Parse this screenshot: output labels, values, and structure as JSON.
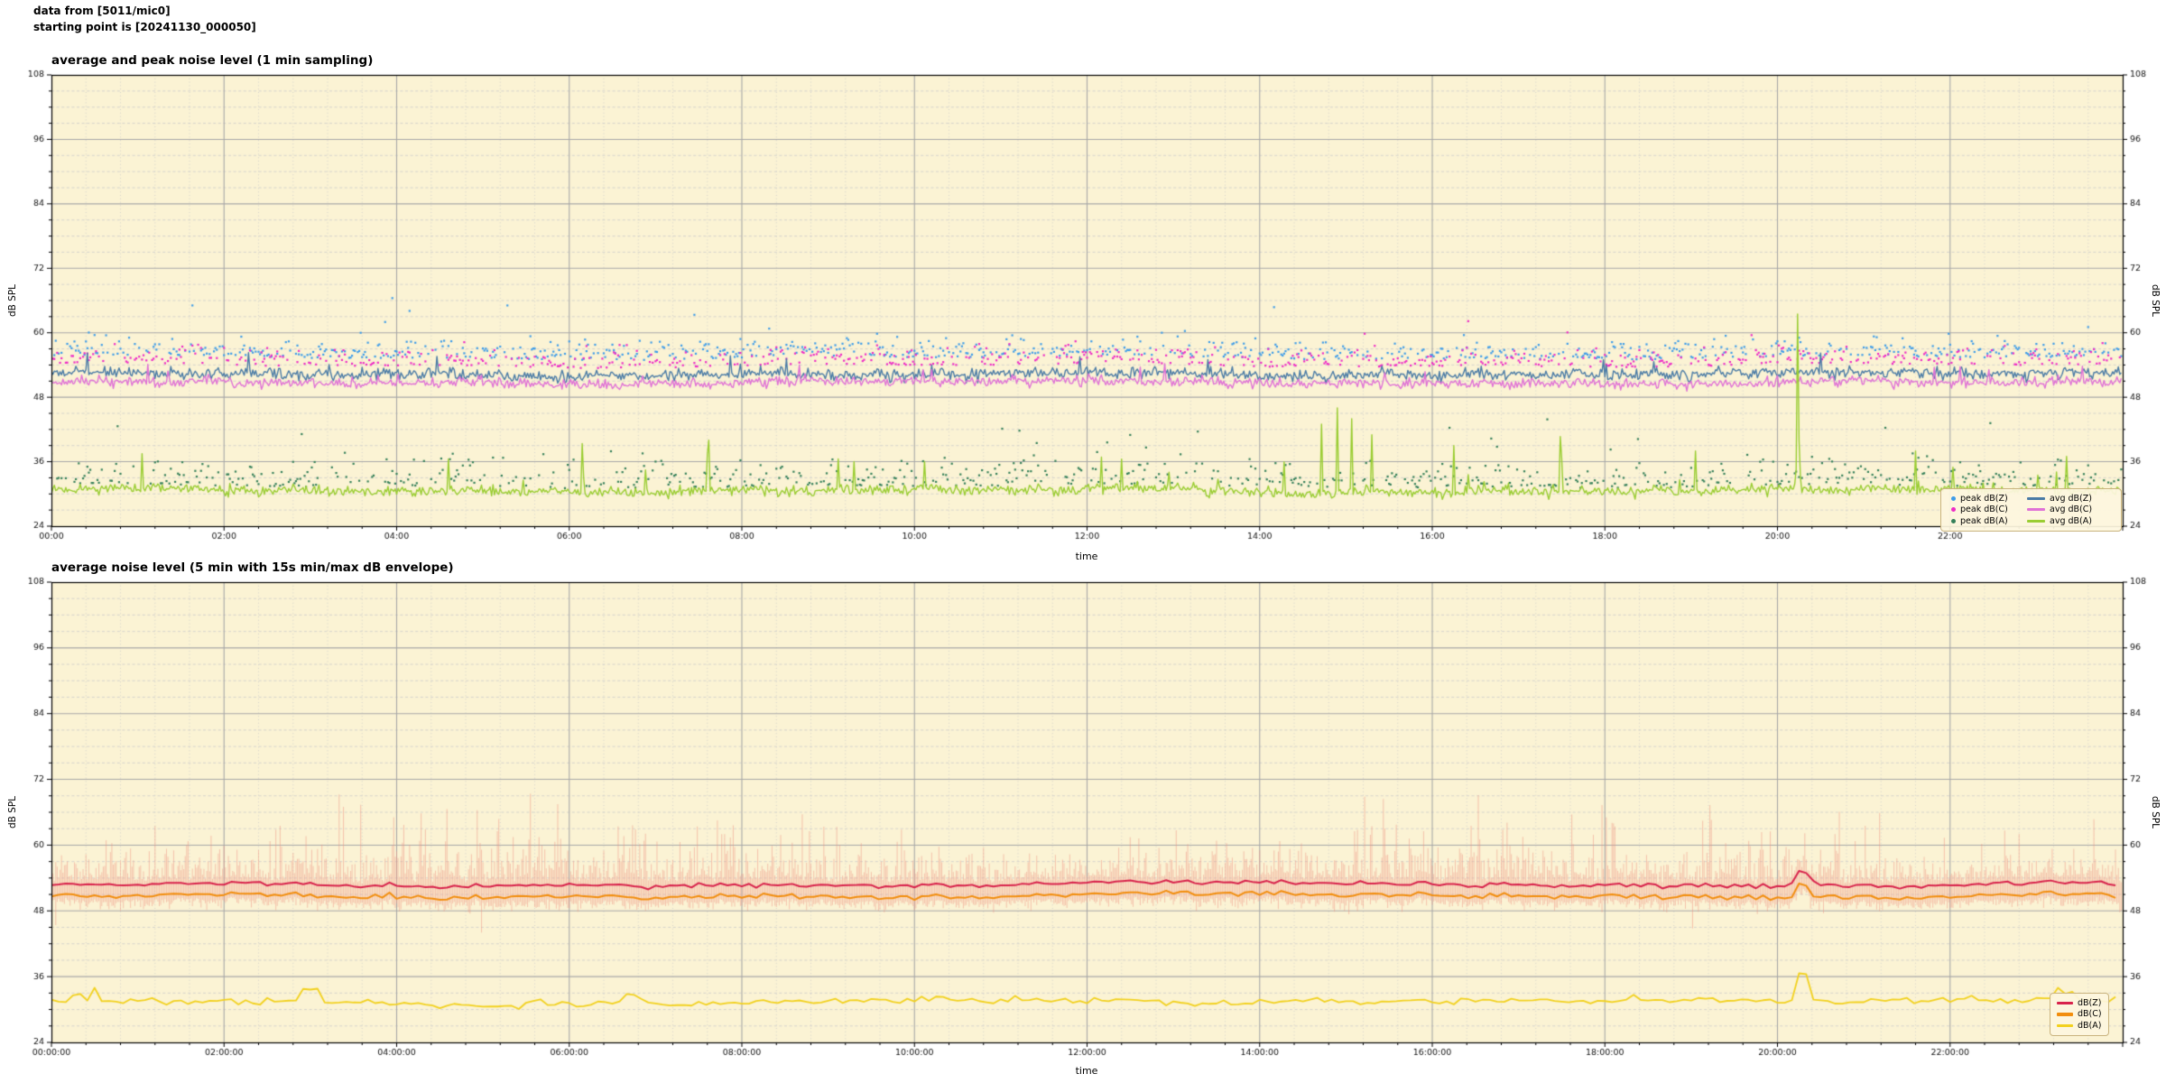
{
  "header": {
    "line1": "data from [5011/mic0]",
    "line2": "starting point is [20241130_000050]"
  },
  "chart_data": [
    {
      "type": "scatter",
      "title": "average and peak noise level (1 min sampling)",
      "xlabel": "time",
      "ylabel": "dB SPL",
      "ylabel_right": "dB SPL",
      "ylim": [
        24,
        108
      ],
      "ytick_labels": [
        "24",
        "36",
        "48",
        "60",
        "72",
        "84",
        "96",
        "108"
      ],
      "ytick_step_db": 12,
      "yminor_step_db": 3,
      "duration_hours": 24,
      "sampling_minutes": 1,
      "xtick_labels": [
        "00:00",
        "02:00",
        "04:00",
        "06:00",
        "08:00",
        "10:00",
        "12:00",
        "14:00",
        "16:00",
        "18:00",
        "20:00",
        "22:00"
      ],
      "xtick_step_hours": 2,
      "xminor_step_minutes": 24,
      "grid": true,
      "legend_position": "lower right",
      "plot_bg": "#fbf3d4",
      "seed": 20241130,
      "series": [
        {
          "name": "peak dB(Z)",
          "kind": "scatter",
          "color": "#3d9ce9",
          "typical_db": 56.2,
          "spread_db": 1.9,
          "rare_rate": 0.014,
          "rare_extra_db": 7,
          "max_db": 71.5,
          "density": 0.55
        },
        {
          "name": "peak dB(C)",
          "kind": "scatter",
          "color": "#ee2cc6",
          "typical_db": 54.7,
          "spread_db": 1.8,
          "rare_rate": 0.01,
          "rare_extra_db": 5,
          "max_db": 63.5,
          "density": 0.5
        },
        {
          "name": "peak dB(A)",
          "kind": "scatter",
          "color": "#35805a",
          "typical_db": 32.6,
          "spread_db": 2.7,
          "rare_rate": 0.03,
          "rare_extra_db": 8,
          "max_db": 47.0,
          "density": 0.5
        },
        {
          "name": "avg dB(Z)",
          "kind": "line",
          "color": "#4a7ba6",
          "typical_db": 52.3,
          "noise_db": 0.5,
          "spike_rate": 0.02,
          "spike_max_db": 3.2,
          "line_width": 1.4
        },
        {
          "name": "avg dB(C)",
          "kind": "line",
          "color": "#e072d6",
          "typical_db": 50.7,
          "noise_db": 0.45,
          "spike_rate": 0.012,
          "spike_max_db": 2.2,
          "line_width": 1.4
        },
        {
          "name": "avg dB(A)",
          "kind": "line",
          "color": "#9acd32",
          "typical_db": 30.6,
          "noise_db": 0.45,
          "spike_rate": 0.012,
          "spike_max_db": 9,
          "line_width": 1.4,
          "extra_spikes": [
            {
              "hour": 1.05,
              "db": 37.5
            },
            {
              "hour": 4.6,
              "db": 36.5
            },
            {
              "hour": 7.62,
              "db": 40.0
            },
            {
              "hour": 9.3,
              "db": 36.0
            },
            {
              "hour": 12.4,
              "db": 36.5
            },
            {
              "hour": 14.72,
              "db": 43.0
            },
            {
              "hour": 14.9,
              "db": 46.0
            },
            {
              "hour": 15.07,
              "db": 44.0
            },
            {
              "hour": 15.3,
              "db": 41.0
            },
            {
              "hour": 16.25,
              "db": 39.0
            },
            {
              "hour": 17.5,
              "db": 36.5
            },
            {
              "hour": 19.05,
              "db": 38.0
            },
            {
              "hour": 21.6,
              "db": 38.0
            },
            {
              "hour": 23.35,
              "db": 37.0
            }
          ],
          "event": {
            "hour": 20.23,
            "peak_db": 63.5
          }
        }
      ],
      "notable_event": {
        "time": "20:14",
        "description": "large avg dB(A) spike",
        "peak_db": 63.5
      }
    },
    {
      "type": "line",
      "title": "average noise level (5 min with 15s min/max dB envelope)",
      "xlabel": "time",
      "ylabel": "dB SPL",
      "ylabel_right": "dB SPL",
      "ylim": [
        24,
        108
      ],
      "ytick_labels": [
        "24",
        "36",
        "48",
        "60",
        "72",
        "84",
        "96",
        "108"
      ],
      "ytick_step_db": 12,
      "yminor_step_db": 3,
      "duration_hours": 24,
      "sampling_minutes": 5,
      "xtick_labels": [
        "00:00:00",
        "02:00:00",
        "04:00:00",
        "06:00:00",
        "08:00:00",
        "10:00:00",
        "12:00:00",
        "14:00:00",
        "16:00:00",
        "18:00:00",
        "20:00:00",
        "22:00:00"
      ],
      "xtick_step_hours": 2,
      "xminor_step_minutes": 24,
      "grid": true,
      "legend_position": "lower right",
      "plot_bg": "#fbf3d4",
      "series": [
        {
          "name": "dB(Z)",
          "kind": "line",
          "color": "#d8234c",
          "typical_db": 52.8,
          "noise_db": 0.2,
          "line_width": 2.0,
          "event": {
            "hour": 20.23,
            "peak_db": 55.3
          }
        },
        {
          "name": "dB(C)",
          "kind": "line",
          "color": "#f28e0e",
          "typical_db": 50.8,
          "noise_db": 0.15,
          "line_width": 2.0,
          "event": {
            "hour": 20.23,
            "peak_db": 53.0
          }
        },
        {
          "name": "dB(A)",
          "kind": "line",
          "color": "#f2d11e",
          "typical_db": 31.4,
          "noise_db": 0.28,
          "line_width": 1.8,
          "event": {
            "hour": 20.23,
            "peak_db": 36.6
          }
        }
      ],
      "envelope": {
        "color": "#f09684",
        "opacity": 0.5,
        "resolution_seconds": 15,
        "typical_max_db": 56.5,
        "extreme_max_db": 70.5,
        "typical_min_db": 48.5,
        "extreme_min_db": 44.0
      },
      "notable_event": {
        "time": "20:14",
        "description": "dB(A) bump to ~36.6, dB(Z) bump to ~55.3",
        "peak_db": 55.3
      }
    }
  ]
}
